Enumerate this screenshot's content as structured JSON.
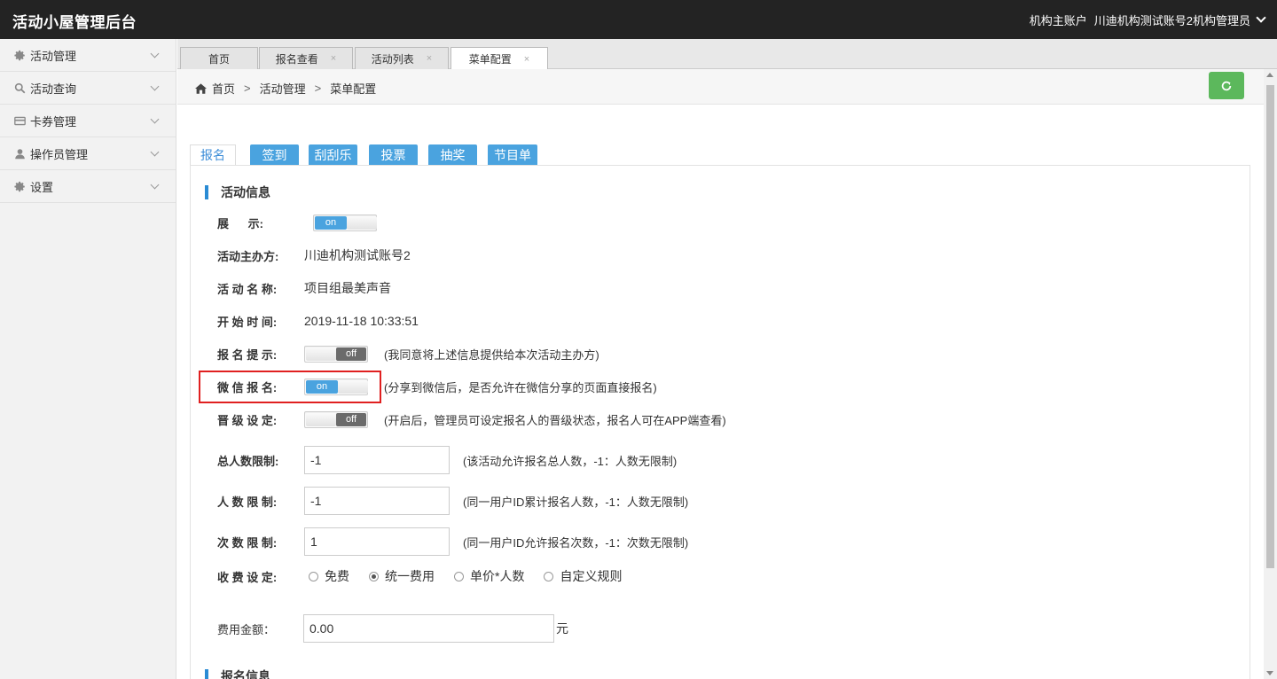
{
  "app": {
    "title": "活动小屋管理后台",
    "account_label": "机构主账户",
    "account_name": "川迪机构测试账号2机构管理员"
  },
  "sidebar": {
    "items": [
      {
        "label": "活动管理",
        "icon": "gear-icon"
      },
      {
        "label": "活动查询",
        "icon": "search-icon"
      },
      {
        "label": "卡券管理",
        "icon": "card-icon"
      },
      {
        "label": "操作员管理",
        "icon": "user-icon"
      },
      {
        "label": "设置",
        "icon": "gear-icon"
      }
    ]
  },
  "tabs": [
    {
      "label": "首页",
      "closable": false
    },
    {
      "label": "报名查看",
      "closable": true
    },
    {
      "label": "活动列表",
      "closable": true
    },
    {
      "label": "菜单配置",
      "closable": true,
      "active": true
    }
  ],
  "tab_close_glyph": "×",
  "breadcrumb": {
    "items": [
      "首页",
      "活动管理",
      "菜单配置"
    ],
    "separator": ">"
  },
  "subtabs": [
    {
      "label": "报名",
      "active": true
    },
    {
      "label": "签到"
    },
    {
      "label": "刮刮乐"
    },
    {
      "label": "投票"
    },
    {
      "label": "抽奖"
    },
    {
      "label": "节目单"
    }
  ],
  "section_activity": "活动信息",
  "section_signup": "报名信息",
  "switch_text": {
    "on": "on",
    "off": "off"
  },
  "fields": {
    "display": {
      "label": "展      示:",
      "state": "on"
    },
    "organizer": {
      "label": "活动主办方:",
      "value": "川迪机构测试账号2"
    },
    "name": {
      "label": "活 动 名 称:",
      "value": "项目组最美声音"
    },
    "start": {
      "label": "开 始 时 间:",
      "value": "2019-11-18 10:33:51"
    },
    "signup_tip": {
      "label": "报 名 提 示:",
      "state": "off",
      "hint": "(我同意将上述信息提供给本次活动主办方)"
    },
    "wechat_signup": {
      "label": "微 信 报 名:",
      "state": "on",
      "hint": "(分享到微信后，是否允许在微信分享的页面直接报名)"
    },
    "level": {
      "label": "晋 级 设 定:",
      "state": "off",
      "hint": "(开启后，管理员可设定报名人的晋级状态，报名人可在APP端查看)"
    },
    "total_limit": {
      "label": "总人数限制:",
      "value": "-1",
      "hint": "(该活动允许报名总人数，-1：人数无限制)"
    },
    "person_limit": {
      "label": "人 数 限 制:",
      "value": "-1",
      "hint": "(同一用户ID累计报名人数，-1：人数无限制)"
    },
    "times_limit": {
      "label": "次 数 限 制:",
      "value": "1",
      "hint": "(同一用户ID允许报名次数，-1：次数无限制)"
    },
    "fee_setting": {
      "label": "收 费 设 定:",
      "options": [
        "免费",
        "统一费用",
        "单价*人数",
        "自定义规则"
      ],
      "selected": "统一费用"
    },
    "fee_amount": {
      "label": "费用金额：",
      "value": "0.00",
      "unit": "元"
    }
  },
  "colors": {
    "topbar": "#232323",
    "accent_blue": "#4aa3df",
    "refresh_green": "#5cb85c",
    "highlight_red": "#e02020"
  }
}
